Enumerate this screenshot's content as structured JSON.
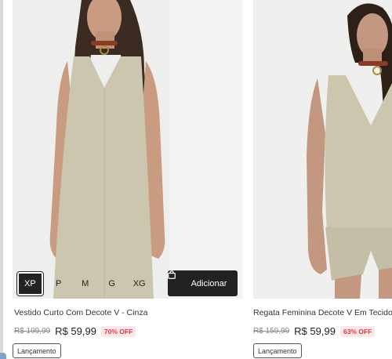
{
  "products": [
    {
      "title": "Vestido Curto Com Decote V - Cinza",
      "old_price": "R$ 199,99",
      "new_price": "R$ 59,99",
      "discount": "70% OFF",
      "badge": "Lançamento",
      "sizes": [
        "XP",
        "P",
        "M",
        "G",
        "XG"
      ],
      "selected_size": "XP",
      "add_label": "Adicionar",
      "image": "model-in-sage-sleeveless-mini-dress"
    },
    {
      "title": "Regata Feminina Decote V Em Tecido Cr",
      "old_price": "R$ 159,99",
      "new_price": "R$ 59,99",
      "discount": "63% OFF",
      "badge": "Lançamento",
      "image": "model-in-sage-v-neck-tank-and-shorts"
    }
  ],
  "colors": {
    "garment": "#ccc6ae",
    "discount_text": "#d63a4a",
    "discount_bg": "#fde7e9",
    "button_dark": "#222222"
  },
  "icons": [
    "shopping-bag-icon"
  ]
}
